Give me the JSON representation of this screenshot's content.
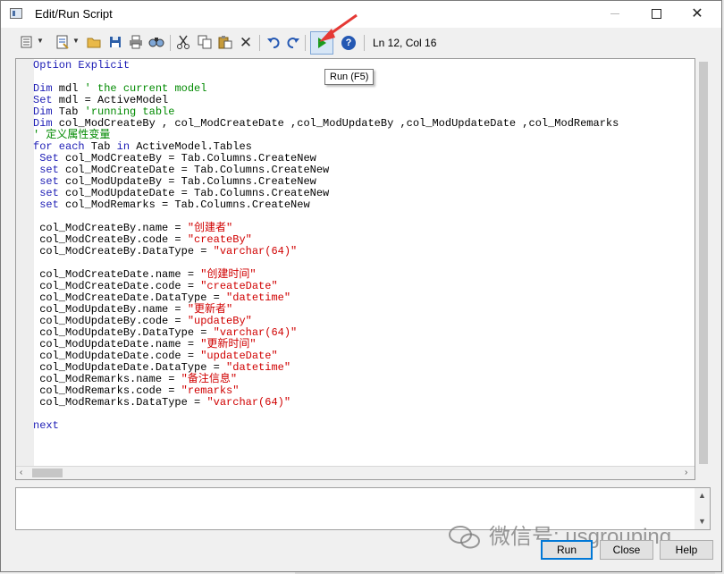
{
  "window": {
    "title": "Edit/Run Script",
    "min_label": "",
    "close_label": "✕"
  },
  "toolbar": {
    "status": "Ln 12, Col 16",
    "run_tooltip": "Run (F5)",
    "icons": [
      "edit-icon",
      "script-icon",
      "open-folder-icon",
      "save-icon",
      "print-icon",
      "find-icon",
      "cut-icon",
      "copy-icon",
      "paste-icon",
      "delete-icon",
      "undo-icon",
      "redo-icon",
      "run-icon",
      "help-icon"
    ]
  },
  "editor": {
    "lines": [
      [
        {
          "t": "Option Explicit",
          "c": "kw"
        }
      ],
      [],
      [
        {
          "t": "Dim",
          "c": "kw"
        },
        {
          "t": " mdl "
        },
        {
          "t": "' the current model",
          "c": "cm"
        }
      ],
      [
        {
          "t": "Set",
          "c": "kw"
        },
        {
          "t": " mdl = ActiveModel"
        }
      ],
      [
        {
          "t": "Dim",
          "c": "kw"
        },
        {
          "t": " Tab "
        },
        {
          "t": "'running table",
          "c": "cm"
        }
      ],
      [
        {
          "t": "Dim",
          "c": "kw"
        },
        {
          "t": " col_ModCreateBy , col_ModCreateDate ,col_ModUpdateBy ,col_ModUpdateDate ,col_ModRemarks"
        }
      ],
      [
        {
          "t": "' 定义属性变量",
          "c": "cm"
        }
      ],
      [
        {
          "t": "for each",
          "c": "kw"
        },
        {
          "t": " Tab "
        },
        {
          "t": "in",
          "c": "kw"
        },
        {
          "t": " ActiveModel.Tables"
        }
      ],
      [
        {
          "t": " "
        },
        {
          "t": "Set",
          "c": "kw"
        },
        {
          "t": " col_ModCreateBy = Tab.Columns.CreateNew"
        }
      ],
      [
        {
          "t": " "
        },
        {
          "t": "set",
          "c": "kw"
        },
        {
          "t": " col_ModCreateDate = Tab.Columns.CreateNew"
        }
      ],
      [
        {
          "t": " "
        },
        {
          "t": "set",
          "c": "kw"
        },
        {
          "t": " col_ModUpdateBy = Tab.Columns.CreateNew"
        }
      ],
      [
        {
          "t": " "
        },
        {
          "t": "set",
          "c": "kw"
        },
        {
          "t": " col_ModUpdateDate = Tab.Columns.CreateNew"
        }
      ],
      [
        {
          "t": " "
        },
        {
          "t": "set",
          "c": "kw"
        },
        {
          "t": " col_ModRemarks = Tab.Columns.CreateNew"
        }
      ],
      [],
      [
        {
          "t": " col_ModCreateBy.name = "
        },
        {
          "t": "\"创建者\"",
          "c": "st"
        }
      ],
      [
        {
          "t": " col_ModCreateBy.code = "
        },
        {
          "t": "\"createBy\"",
          "c": "st"
        }
      ],
      [
        {
          "t": " col_ModCreateBy.DataType = "
        },
        {
          "t": "\"varchar(64)\"",
          "c": "st"
        }
      ],
      [],
      [
        {
          "t": " col_ModCreateDate.name = "
        },
        {
          "t": "\"创建时间\"",
          "c": "st"
        }
      ],
      [
        {
          "t": " col_ModCreateDate.code = "
        },
        {
          "t": "\"createDate\"",
          "c": "st"
        }
      ],
      [
        {
          "t": " col_ModCreateDate.DataType = "
        },
        {
          "t": "\"datetime\"",
          "c": "st"
        }
      ],
      [
        {
          "t": " col_ModUpdateBy.name = "
        },
        {
          "t": "\"更新者\"",
          "c": "st"
        }
      ],
      [
        {
          "t": " col_ModUpdateBy.code = "
        },
        {
          "t": "\"updateBy\"",
          "c": "st"
        }
      ],
      [
        {
          "t": " col_ModUpdateBy.DataType = "
        },
        {
          "t": "\"varchar(64)\"",
          "c": "st"
        }
      ],
      [
        {
          "t": " col_ModUpdateDate.name = "
        },
        {
          "t": "\"更新时间\"",
          "c": "st"
        }
      ],
      [
        {
          "t": " col_ModUpdateDate.code = "
        },
        {
          "t": "\"updateDate\"",
          "c": "st"
        }
      ],
      [
        {
          "t": " col_ModUpdateDate.DataType = "
        },
        {
          "t": "\"datetime\"",
          "c": "st"
        }
      ],
      [
        {
          "t": " col_ModRemarks.name = "
        },
        {
          "t": "\"备注信息\"",
          "c": "st"
        }
      ],
      [
        {
          "t": " col_ModRemarks.code = "
        },
        {
          "t": "\"remarks\"",
          "c": "st"
        }
      ],
      [
        {
          "t": " col_ModRemarks.DataType = "
        },
        {
          "t": "\"varchar(64)\"",
          "c": "st"
        }
      ],
      [],
      [
        {
          "t": "next",
          "c": "kw"
        }
      ]
    ]
  },
  "buttons": {
    "run": "Run",
    "close": "Close",
    "help": "Help"
  },
  "watermark": {
    "text": "微信号: usgrouping"
  },
  "colors": {
    "keyword": "#1d1db5",
    "comment": "#008a00",
    "string": "#d00000",
    "run_green": "#1c9a1c",
    "annotation_arrow": "#e53935"
  }
}
